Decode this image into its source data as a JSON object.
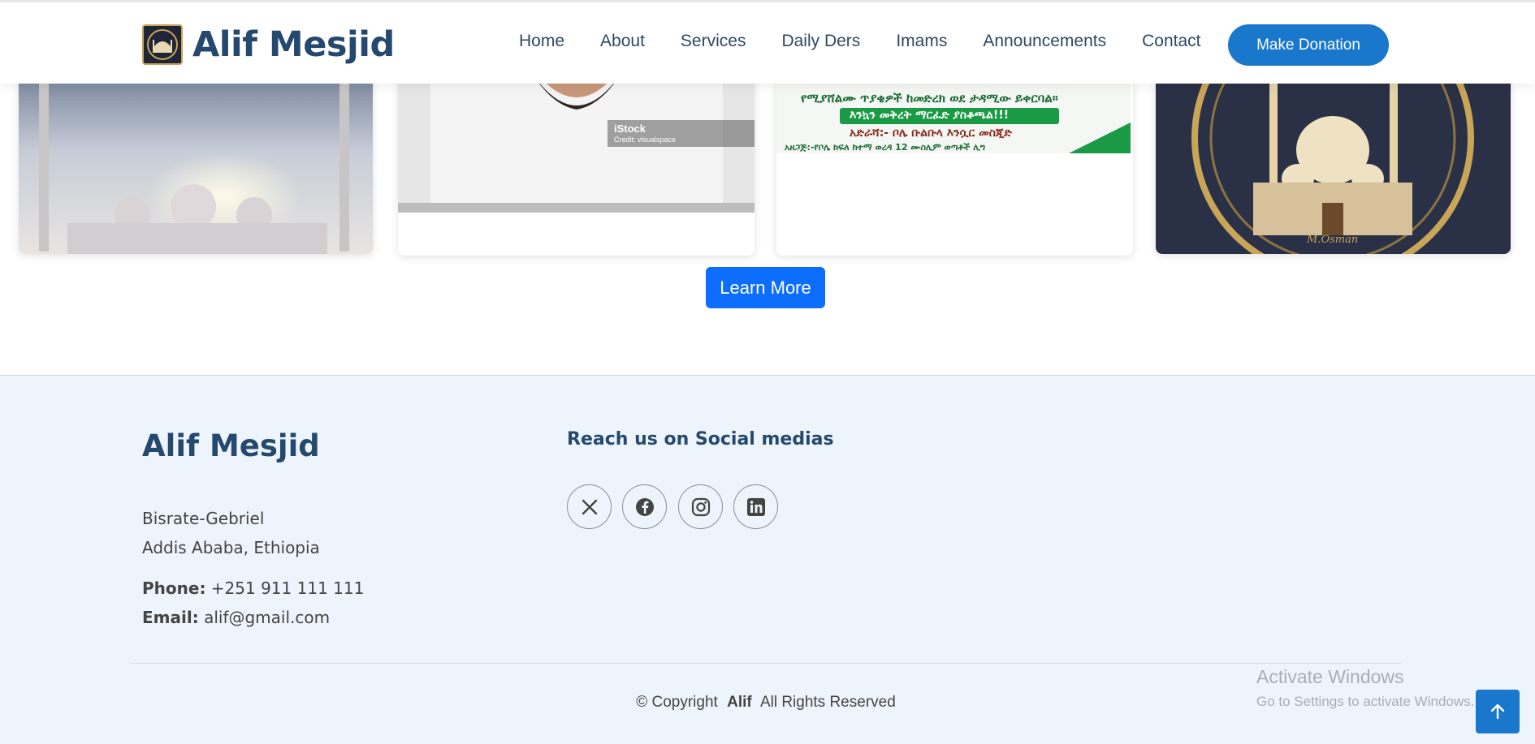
{
  "header": {
    "logo_title": "Alif Mesjid",
    "nav": [
      "Home",
      "About",
      "Services",
      "Daily Ders",
      "Imams",
      "Announcements",
      "Contact"
    ],
    "donate_label": "Make Donation"
  },
  "cards": {
    "card2_watermark": "iStock",
    "card2_credit": "Credit: visualspace",
    "card3_lines": [
      "የሚያሸልሙ ጥያቄዎች ከመድረክ ወደ ታዳሚው ይቀርባል።",
      "እንኳን መቅረት ማርፈድ ያስቆጫል!!!",
      "አድራሻ:- ቦሌ ቡልቡላ እንሷር መስጂድ",
      "አዘጋጅ:-የቦሌ ክፍለ ከተማ ወረዳ 12 ሙስሊም ወጣቶች ሊግ"
    ],
    "card4_signature": "M.Osman"
  },
  "learn_more_label": "Learn More",
  "footer": {
    "title": "Alif Mesjid",
    "address_line1": "Bisrate-Gebriel",
    "address_line2": "Addis Ababa, Ethiopia",
    "phone_label": "Phone:",
    "phone_value": "+251 911 111 111",
    "email_label": "Email:",
    "email_value": "alif@gmail.com",
    "social_title": "Reach us on Social medias",
    "social_icons": [
      "x-icon",
      "facebook-icon",
      "instagram-icon",
      "linkedin-icon"
    ],
    "copyright_prefix": "© Copyright",
    "copyright_brand": "Alif",
    "copyright_suffix": "All Rights Reserved"
  },
  "overlay": {
    "activate_title": "Activate Windows",
    "activate_sub": "Go to Settings to activate Windows."
  },
  "colors": {
    "brand_blue": "#1977cc",
    "heading_navy": "#25486f",
    "button_blue": "#0d6efd",
    "footer_bg": "#eef4fc"
  }
}
